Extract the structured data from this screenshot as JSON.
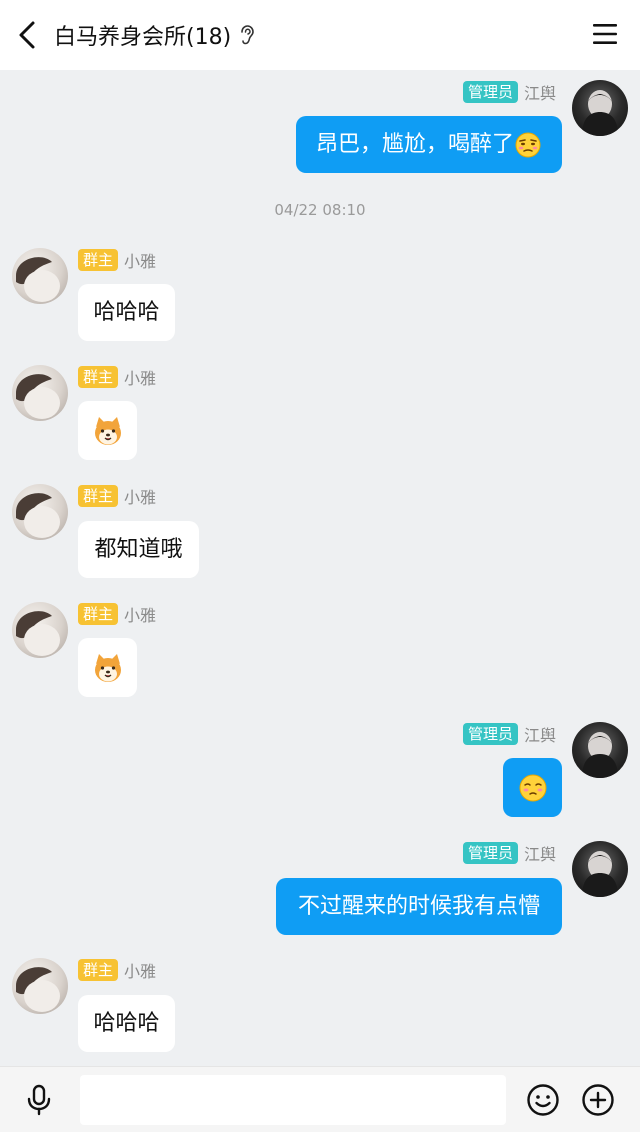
{
  "header": {
    "title": "白马养身会所(18)",
    "back_icon": "chevron-left-icon",
    "ear_icon": "ear-icon",
    "menu_icon": "hamburger-menu-icon"
  },
  "colors": {
    "outgoing_bubble": "#0f9df4",
    "owner_badge": "#f7c233",
    "admin_badge": "#35c4c4",
    "background": "#eef0f2"
  },
  "messages": [
    {
      "direction": "out",
      "badge": "管理员",
      "sender": "江舆",
      "text": "昂巴，尴尬，喝醉了",
      "emoji": "embarrassed-face-emoji"
    },
    {
      "type": "timestamp",
      "text": "04/22 08:10"
    },
    {
      "direction": "in",
      "badge": "群主",
      "sender": "小雅",
      "text": "哈哈哈"
    },
    {
      "direction": "in",
      "badge": "群主",
      "sender": "小雅",
      "sticker": "shiba-dog-sticker"
    },
    {
      "direction": "in",
      "badge": "群主",
      "sender": "小雅",
      "text": "都知道哦"
    },
    {
      "direction": "in",
      "badge": "群主",
      "sender": "小雅",
      "sticker": "shiba-dog-sticker"
    },
    {
      "direction": "out",
      "badge": "管理员",
      "sender": "江舆",
      "emoji": "pleading-face-emoji"
    },
    {
      "direction": "out",
      "badge": "管理员",
      "sender": "江舆",
      "text": "不过醒来的时候我有点懵"
    },
    {
      "direction": "in",
      "badge": "群主",
      "sender": "小雅",
      "text": "哈哈哈"
    }
  ],
  "input": {
    "value": "",
    "placeholder": ""
  },
  "bottombar": {
    "voice_icon": "microphone-icon",
    "emoji_icon": "smiley-face-icon",
    "plus_icon": "plus-circle-icon"
  }
}
